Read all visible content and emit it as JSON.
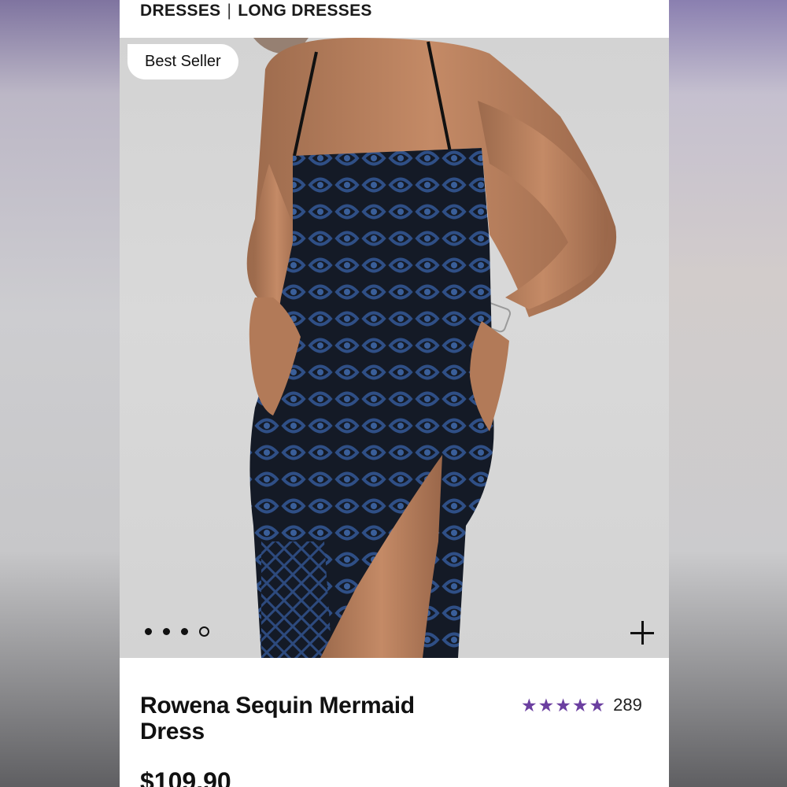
{
  "breadcrumb": {
    "level1": "DRESSES",
    "separator": "|",
    "level2": "LONG DRESSES"
  },
  "badge": {
    "label": "Best Seller"
  },
  "gallery": {
    "image_count": 4,
    "active_index": 3
  },
  "product": {
    "title_line1": "Rowena Sequin Mermaid",
    "title_line2": "Dress",
    "price": "$109.90",
    "rating": {
      "stars": 5,
      "review_count": "289"
    }
  },
  "colors": {
    "accent": "#6b3fa0",
    "dress": "#1e2f4f",
    "background": "#d6d6d6"
  }
}
